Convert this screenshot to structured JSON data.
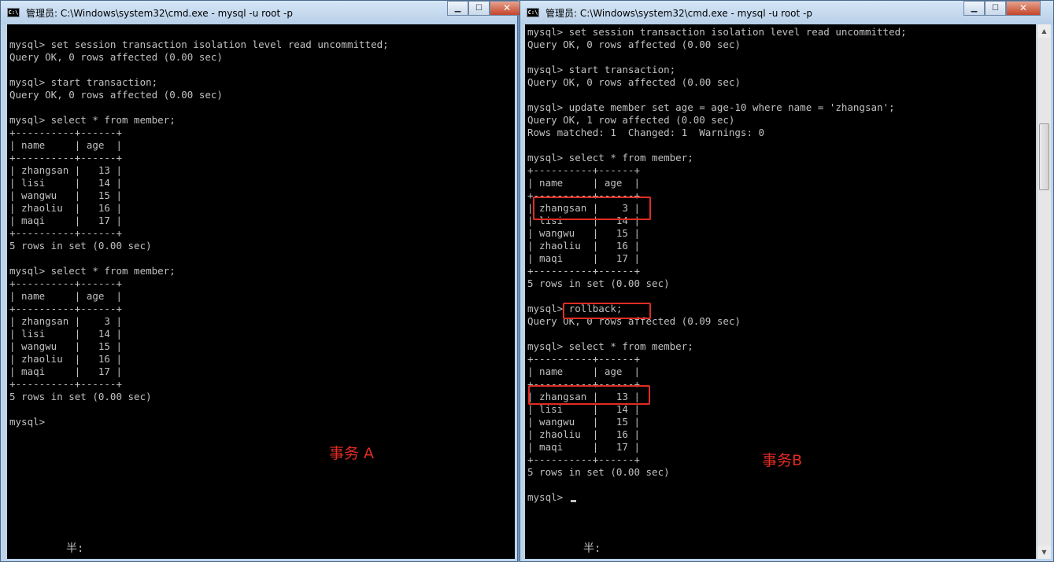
{
  "window_a": {
    "title": "管理员: C:\\Windows\\system32\\cmd.exe - mysql  -u root -p",
    "lines": [
      "",
      "mysql> set session transaction isolation level read uncommitted;",
      "Query OK, 0 rows affected (0.00 sec)",
      "",
      "mysql> start transaction;",
      "Query OK, 0 rows affected (0.00 sec)",
      "",
      "mysql> select * from member;",
      "+----------+------+",
      "| name     | age  |",
      "+----------+------+",
      "| zhangsan |   13 |",
      "| lisi     |   14 |",
      "| wangwu   |   15 |",
      "| zhaoliu  |   16 |",
      "| maqi     |   17 |",
      "+----------+------+",
      "5 rows in set (0.00 sec)",
      "",
      "mysql> select * from member;",
      "+----------+------+",
      "| name     | age  |",
      "+----------+------+",
      "| zhangsan |    3 |",
      "| lisi     |   14 |",
      "| wangwu   |   15 |",
      "| zhaoliu  |   16 |",
      "| maqi     |   17 |",
      "+----------+------+",
      "5 rows in set (0.00 sec)",
      "",
      "mysql>"
    ],
    "annotation": "事务 A",
    "ime_status": "半:"
  },
  "window_b": {
    "title": "管理员: C:\\Windows\\system32\\cmd.exe - mysql  -u root -p",
    "lines": [
      "mysql> set session transaction isolation level read uncommitted;",
      "Query OK, 0 rows affected (0.00 sec)",
      "",
      "mysql> start transaction;",
      "Query OK, 0 rows affected (0.00 sec)",
      "",
      "mysql> update member set age = age-10 where name = 'zhangsan';",
      "Query OK, 1 row affected (0.00 sec)",
      "Rows matched: 1  Changed: 1  Warnings: 0",
      "",
      "mysql> select * from member;",
      "+----------+------+",
      "| name     | age  |",
      "+----------+------+",
      "| zhangsan |    3 |",
      "| lisi     |   14 |",
      "| wangwu   |   15 |",
      "| zhaoliu  |   16 |",
      "| maqi     |   17 |",
      "+----------+------+",
      "5 rows in set (0.00 sec)",
      "",
      "mysql> rollback;",
      "Query OK, 0 rows affected (0.09 sec)",
      "",
      "mysql> select * from member;",
      "+----------+------+",
      "| name     | age  |",
      "+----------+------+",
      "| zhangsan |   13 |",
      "| lisi     |   14 |",
      "| wangwu   |   15 |",
      "| zhaoliu  |   16 |",
      "| maqi     |   17 |",
      "+----------+------+",
      "5 rows in set (0.00 sec)",
      "",
      "mysql>"
    ],
    "annotation": "事务B",
    "ime_status": "半:"
  },
  "colors": {
    "highlight": "#e02c22",
    "console_bg": "#000000",
    "console_text": "#c0c0c0"
  },
  "icons": {
    "app": "cmd-icon",
    "minimize": "minimize-icon",
    "maximize": "maximize-icon",
    "close": "close-icon"
  }
}
